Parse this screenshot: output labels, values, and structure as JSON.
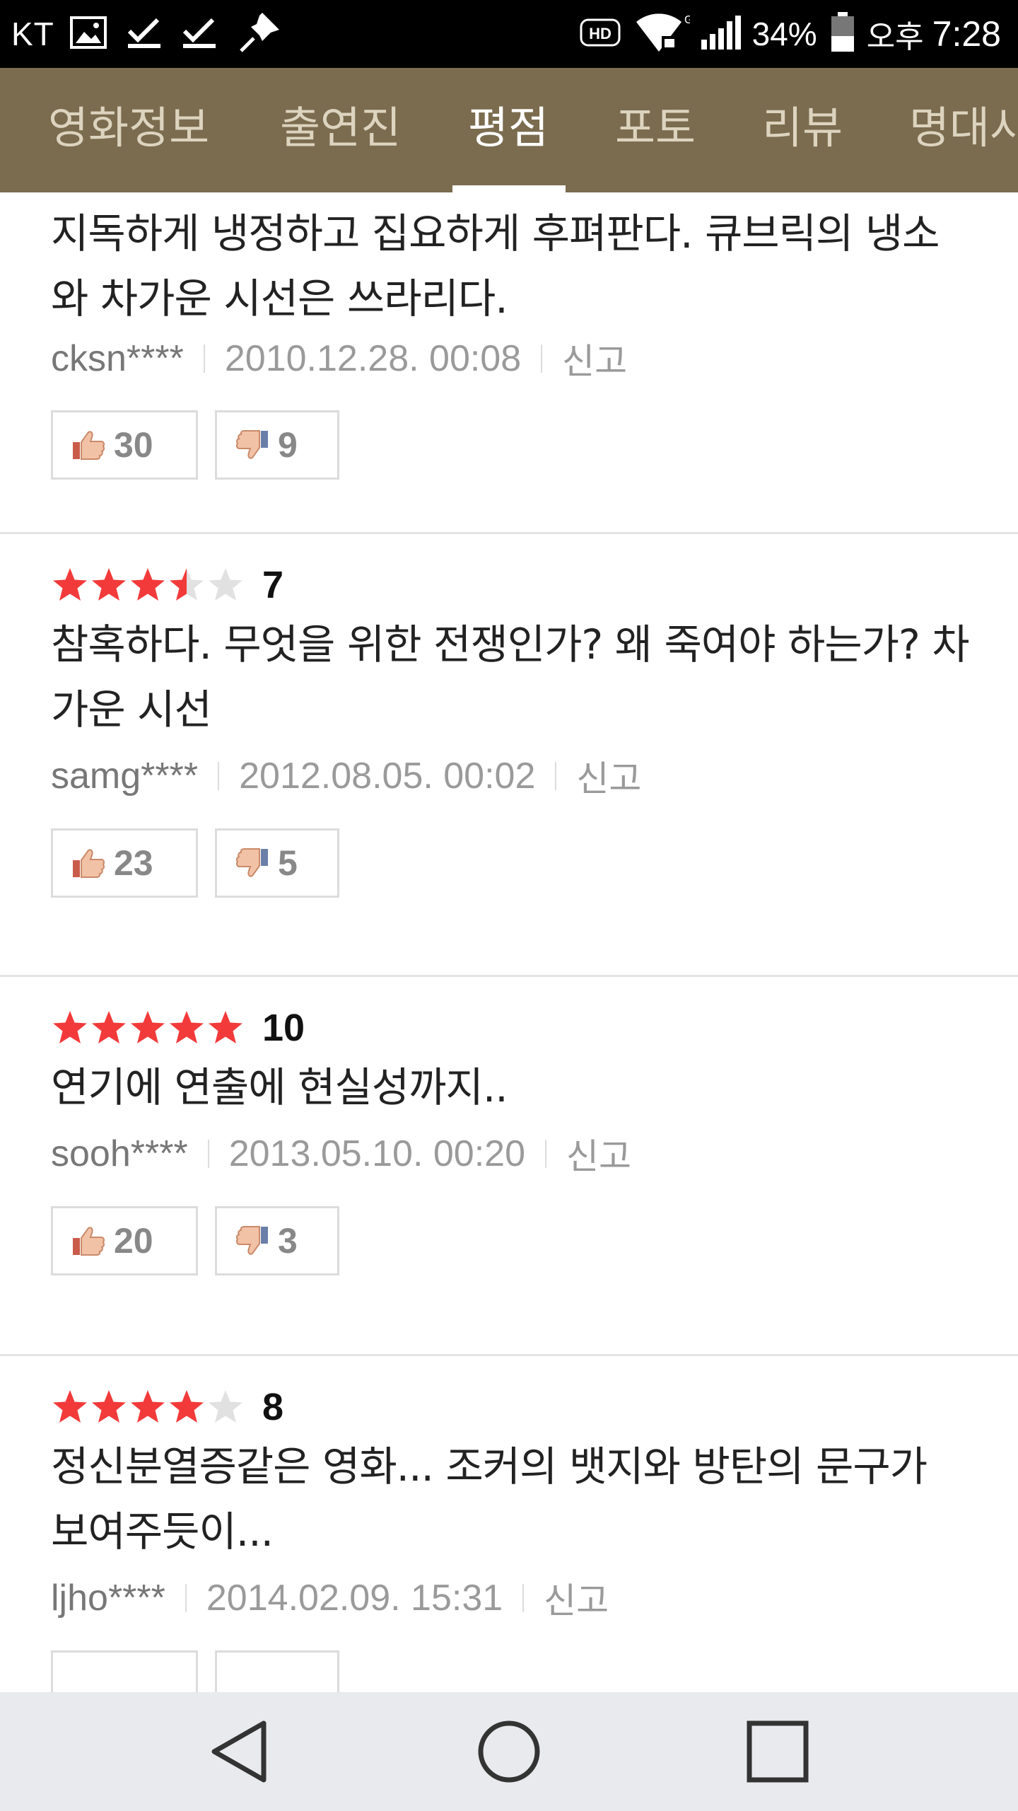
{
  "status_bar": {
    "carrier": "KT",
    "battery": "34%",
    "ampm": "오후",
    "time": "7:28",
    "icons": [
      "gallery-icon",
      "check-icon",
      "check-icon",
      "pin-icon",
      "hd-icon",
      "wifi-icon",
      "signal-icon",
      "battery-icon"
    ]
  },
  "tabs": [
    {
      "label": "영화정보",
      "active": false
    },
    {
      "label": "출연진",
      "active": false
    },
    {
      "label": "평점",
      "active": true
    },
    {
      "label": "포토",
      "active": false
    },
    {
      "label": "리뷰",
      "active": false
    },
    {
      "label": "명대사",
      "active": false
    }
  ],
  "colors": {
    "tab_bar": "#7b6c4f",
    "star_on": "#f23a3a",
    "star_off": "#e1e1e1"
  },
  "reviews": [
    {
      "rating": null,
      "score": "",
      "comment": "지독하게 냉정하고 집요하게 후펴판다. 큐브릭의 냉소와 차가운 시선은 쓰라리다.",
      "user": "cksn****",
      "date": "2010.12.28. 00:08",
      "report": "신고",
      "likes": "30",
      "dislikes": "9"
    },
    {
      "rating": 3.5,
      "score": "7",
      "comment": "참혹하다. 무엇을 위한 전쟁인가? 왜 죽여야 하는가? 차가운 시선",
      "user": "samg****",
      "date": "2012.08.05. 00:02",
      "report": "신고",
      "likes": "23",
      "dislikes": "5"
    },
    {
      "rating": 5,
      "score": "10",
      "comment": "연기에 연출에 현실성까지..",
      "user": "sooh****",
      "date": "2013.05.10. 00:20",
      "report": "신고",
      "likes": "20",
      "dislikes": "3"
    },
    {
      "rating": 4,
      "score": "8",
      "comment": "정신분열증같은 영화... 조커의 뱃지와 방탄의 문구가 보여주듯이...",
      "user": "ljho****",
      "date": "2014.02.09. 15:31",
      "report": "신고",
      "likes": "",
      "dislikes": ""
    }
  ],
  "nav_bar": {
    "buttons": [
      "back-icon",
      "home-icon",
      "recents-icon"
    ]
  }
}
